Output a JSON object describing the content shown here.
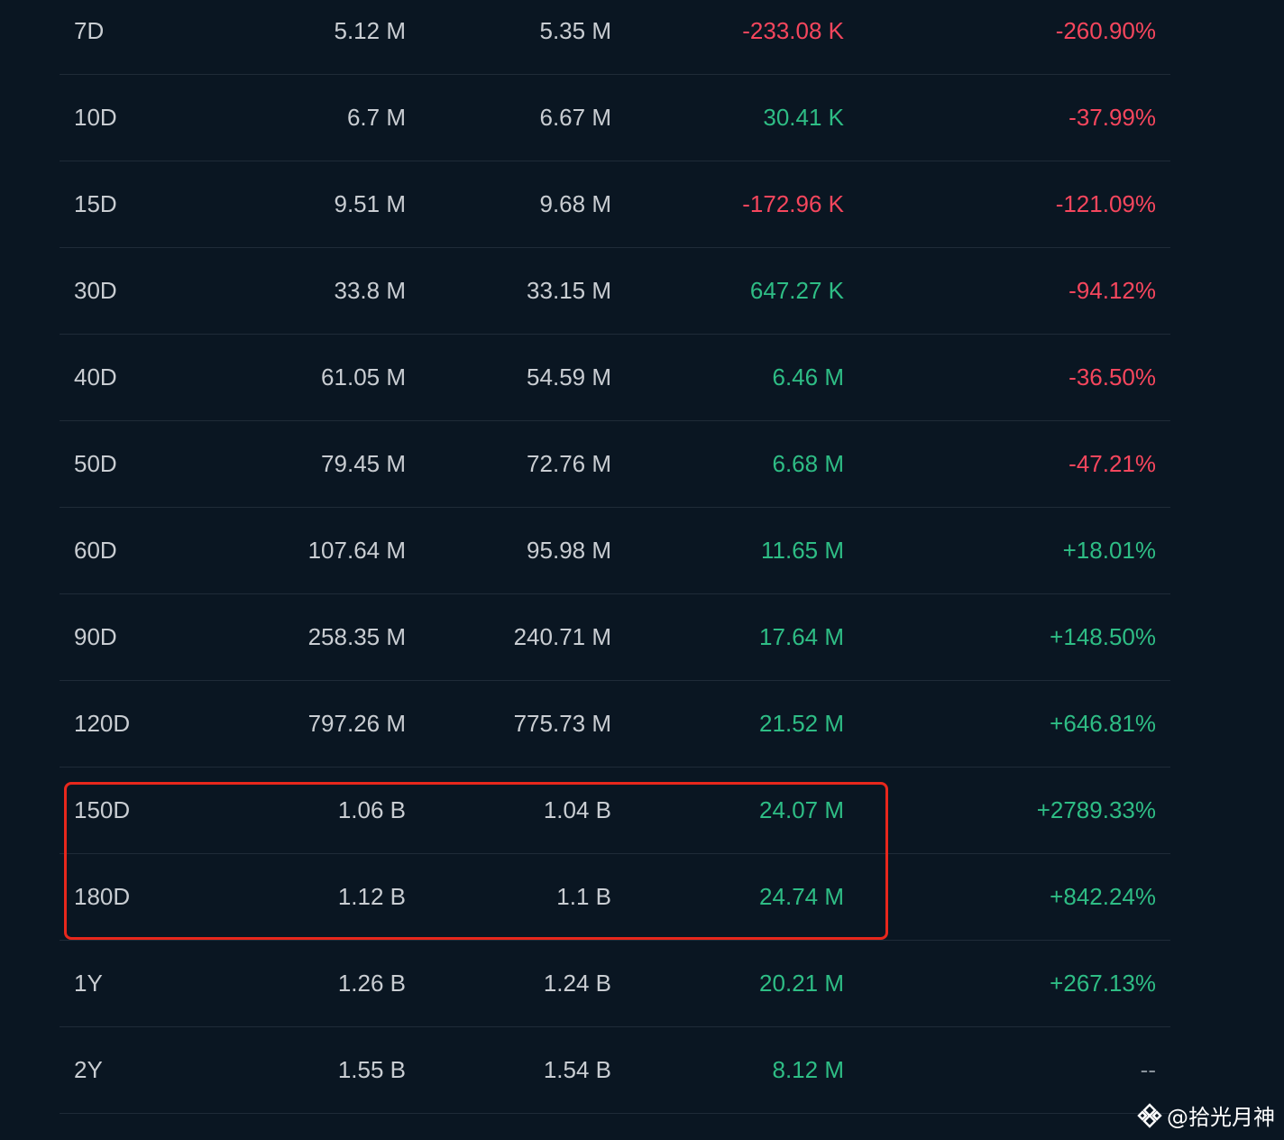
{
  "rows": [
    {
      "period": "7D",
      "a": "5.12 M",
      "b": "5.35 M",
      "net": "-233.08 K",
      "net_sign": "neg",
      "pct": "-260.90%",
      "pct_sign": "neg"
    },
    {
      "period": "10D",
      "a": "6.7 M",
      "b": "6.67 M",
      "net": "30.41 K",
      "net_sign": "pos",
      "pct": "-37.99%",
      "pct_sign": "neg"
    },
    {
      "period": "15D",
      "a": "9.51 M",
      "b": "9.68 M",
      "net": "-172.96 K",
      "net_sign": "neg",
      "pct": "-121.09%",
      "pct_sign": "neg"
    },
    {
      "period": "30D",
      "a": "33.8 M",
      "b": "33.15 M",
      "net": "647.27 K",
      "net_sign": "pos",
      "pct": "-94.12%",
      "pct_sign": "neg"
    },
    {
      "period": "40D",
      "a": "61.05 M",
      "b": "54.59 M",
      "net": "6.46 M",
      "net_sign": "pos",
      "pct": "-36.50%",
      "pct_sign": "neg"
    },
    {
      "period": "50D",
      "a": "79.45 M",
      "b": "72.76 M",
      "net": "6.68 M",
      "net_sign": "pos",
      "pct": "-47.21%",
      "pct_sign": "neg"
    },
    {
      "period": "60D",
      "a": "107.64 M",
      "b": "95.98 M",
      "net": "11.65 M",
      "net_sign": "pos",
      "pct": "+18.01%",
      "pct_sign": "pos"
    },
    {
      "period": "90D",
      "a": "258.35 M",
      "b": "240.71 M",
      "net": "17.64 M",
      "net_sign": "pos",
      "pct": "+148.50%",
      "pct_sign": "pos"
    },
    {
      "period": "120D",
      "a": "797.26 M",
      "b": "775.73 M",
      "net": "21.52 M",
      "net_sign": "pos",
      "pct": "+646.81%",
      "pct_sign": "pos"
    },
    {
      "period": "150D",
      "a": "1.06 B",
      "b": "1.04 B",
      "net": "24.07 M",
      "net_sign": "pos",
      "pct": "+2789.33%",
      "pct_sign": "pos"
    },
    {
      "period": "180D",
      "a": "1.12 B",
      "b": "1.1 B",
      "net": "24.74 M",
      "net_sign": "pos",
      "pct": "+842.24%",
      "pct_sign": "pos"
    },
    {
      "period": "1Y",
      "a": "1.26 B",
      "b": "1.24 B",
      "net": "20.21 M",
      "net_sign": "pos",
      "pct": "+267.13%",
      "pct_sign": "pos"
    },
    {
      "period": "2Y",
      "a": "1.55 B",
      "b": "1.54 B",
      "net": "8.12 M",
      "net_sign": "pos",
      "pct": "--",
      "pct_sign": "neu"
    }
  ],
  "highlight": {
    "rows": [
      "150D",
      "180D"
    ],
    "color": "#e8271c"
  },
  "colors": {
    "background": "#0a1622",
    "positive": "#2ebd85",
    "negative": "#f6465d",
    "text": "#c9cdd2"
  },
  "watermark": {
    "text": "@拾光月神",
    "icon": "binance-square-logo-icon"
  }
}
